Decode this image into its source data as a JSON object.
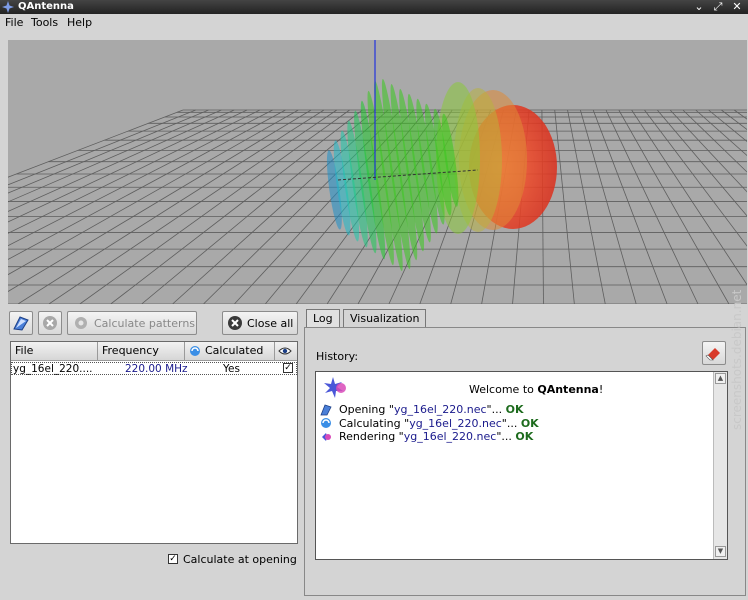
{
  "window": {
    "title": "QAntenna"
  },
  "menubar": {
    "file": "File",
    "tools": "Tools",
    "help": "Help"
  },
  "toolbar": {
    "calculate_label": "Calculate patterns",
    "close_all_label": "Close all"
  },
  "file_table": {
    "headers": {
      "file": "File",
      "frequency": "Frequency",
      "calculated": "Calculated"
    },
    "rows": [
      {
        "file": "yg_16el_220....",
        "frequency": "220.00 MHz",
        "calculated": "Yes",
        "visible": true
      }
    ]
  },
  "calc_at_opening": {
    "label": "Calculate at opening",
    "checked": true
  },
  "tabs": {
    "log": "Log",
    "visualization": "Visualization"
  },
  "history": {
    "label": "History:",
    "welcome_prefix": "Welcome to ",
    "welcome_app": "QAntenna",
    "welcome_suffix": "!",
    "lines": [
      {
        "prefix": "Opening \"",
        "file": "yg_16el_220.nec",
        "suffix": "\"... ",
        "status": "OK"
      },
      {
        "prefix": "Calculating \"",
        "file": "yg_16el_220.nec",
        "suffix": "\"... ",
        "status": "OK"
      },
      {
        "prefix": "Rendering \"",
        "file": "yg_16el_220.nec",
        "suffix": "\"... ",
        "status": "OK"
      }
    ]
  },
  "watermark": "screenshots.debian.net"
}
